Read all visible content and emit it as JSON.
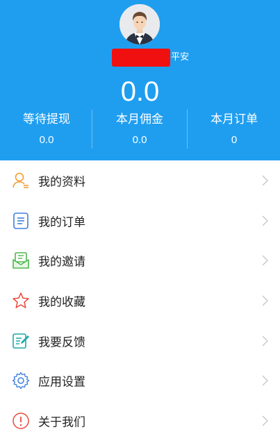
{
  "header": {
    "user_tag": "平安",
    "balance": "0.0",
    "stats": [
      {
        "label": "等待提现",
        "value": "0.0"
      },
      {
        "label": "本月佣金",
        "value": "0.0"
      },
      {
        "label": "本月订单",
        "value": "0"
      }
    ]
  },
  "menu": [
    {
      "label": "我的资料",
      "icon": "person-icon"
    },
    {
      "label": "我的订单",
      "icon": "order-list-icon"
    },
    {
      "label": "我的邀请",
      "icon": "invite-icon"
    },
    {
      "label": "我的收藏",
      "icon": "star-icon"
    },
    {
      "label": "我要反馈",
      "icon": "feedback-edit-icon"
    },
    {
      "label": "应用设置",
      "icon": "gear-icon"
    },
    {
      "label": "关于我们",
      "icon": "info-icon"
    }
  ],
  "colors": {
    "header_bg": "#1f9ef0",
    "icon_orange": "#f39b33",
    "icon_blue": "#3f7fe0",
    "icon_green": "#4cb84c",
    "icon_red": "#e84a3c"
  }
}
